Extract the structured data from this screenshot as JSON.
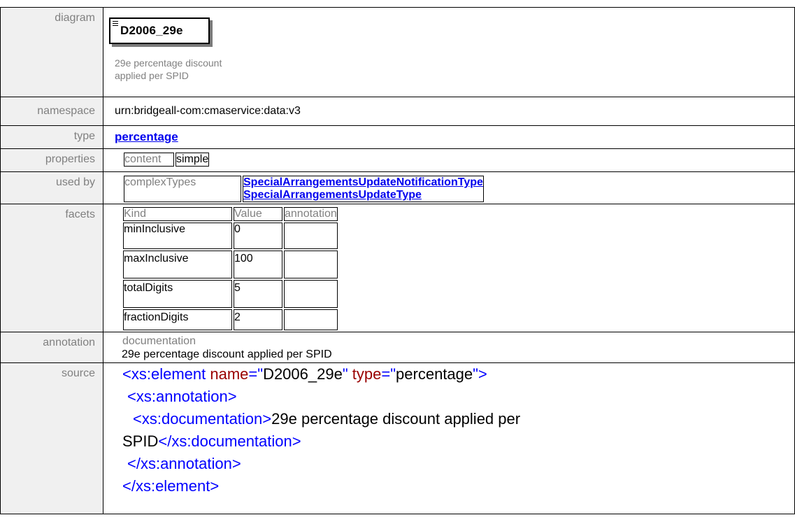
{
  "rows": {
    "diagram": {
      "label": "diagram",
      "element_name": "D2006_29e",
      "element_doc_line1": "29e percentage discount",
      "element_doc_line2": "applied per SPID"
    },
    "namespace": {
      "label": "namespace",
      "value": "urn:bridgeall-com:cmaservice:data:v3"
    },
    "type": {
      "label": "type",
      "value": "percentage"
    },
    "properties": {
      "label": "properties",
      "key": "content",
      "value": "simple"
    },
    "used_by": {
      "label": "used by",
      "kind": "complexTypes",
      "items": [
        "SpecialArrangementsUpdateNotificationType",
        "SpecialArrangementsUpdateType"
      ]
    },
    "facets": {
      "label": "facets",
      "headers": [
        "Kind",
        "Value",
        "annotation"
      ],
      "items": [
        {
          "kind": "minInclusive",
          "value": "0"
        },
        {
          "kind": "maxInclusive",
          "value": "100"
        },
        {
          "kind": "totalDigits",
          "value": "5"
        },
        {
          "kind": "fractionDigits",
          "value": "2"
        }
      ]
    },
    "annotation": {
      "label": "annotation",
      "key": "documentation",
      "value": "29e percentage discount applied per SPID"
    },
    "source": {
      "label": "source",
      "l1_tag": "<xs:element",
      "l1_attr1": " name",
      "l1_eq1": "=\"",
      "l1_val1": "D2006_29e",
      "l1_q1": "\"",
      "l1_attr2": " type",
      "l1_eq2": "=\"",
      "l1_val2": "percentage",
      "l1_end": "\">",
      "l2": "<xs:annotation>",
      "l3_open": "<xs:documentation>",
      "l3_text": "29e percentage discount applied per",
      "l4_text": "SPID",
      "l4_close": "</xs:documentation>",
      "l5": "</xs:annotation>",
      "l6": "</xs:element>"
    }
  },
  "colors": {
    "label_bg": "#f0f0f0",
    "label_text": "#808080",
    "link": "#0000ee",
    "xml_tag": "#0000ff",
    "xml_name": "#990000"
  }
}
